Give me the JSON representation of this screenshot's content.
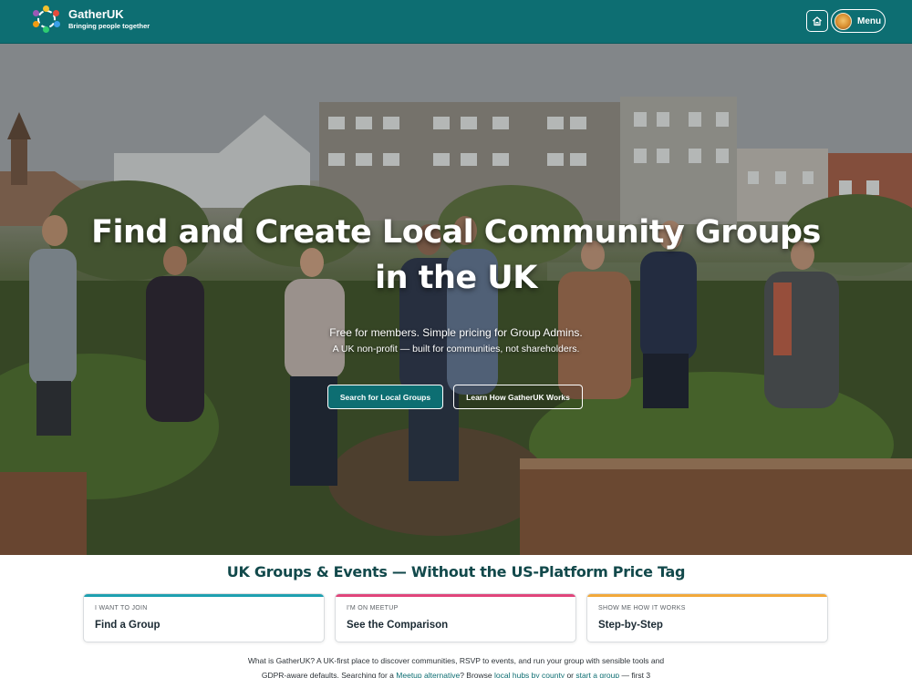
{
  "header": {
    "brand_name": "GatherUK",
    "tagline": "Bringing people together",
    "home_icon": "home-icon",
    "menu_label": "Menu",
    "background": "#0d6e72"
  },
  "hero": {
    "title_line1": "Find and Create Local Community Groups",
    "title_line2": "in the UK",
    "subtitle": "Free for members. Simple pricing for Group Admins.",
    "subtitle2": "A UK non-profit — built for communities, not shareholders.",
    "primary_button": "Search for Local Groups",
    "secondary_button": "Learn How GatherUK Works"
  },
  "section": {
    "title": "UK Groups & Events — Without the US-Platform Price Tag"
  },
  "cards": [
    {
      "kicker": "I WANT TO JOIN",
      "title": "Find a Group",
      "accent": "#1ea0b0"
    },
    {
      "kicker": "I'M ON MEETUP",
      "title": "See the Comparison",
      "accent": "#e0457b"
    },
    {
      "kicker": "SHOW ME HOW IT WORKS",
      "title": "Step-by-Step",
      "accent": "#f2a93b"
    }
  ],
  "intro": {
    "line1": "What is GatherUK? A UK-first place to discover communities, RSVP to events, and run your group with sensible tools and",
    "line2_before": "GDPR-aware defaults. Searching for a",
    "link1": "Meetup alternative",
    "mid1": "? Browse",
    "link2": "local hubs by county",
    "mid2": "or",
    "link3": "start a group",
    "line2_after": "— first 3"
  }
}
